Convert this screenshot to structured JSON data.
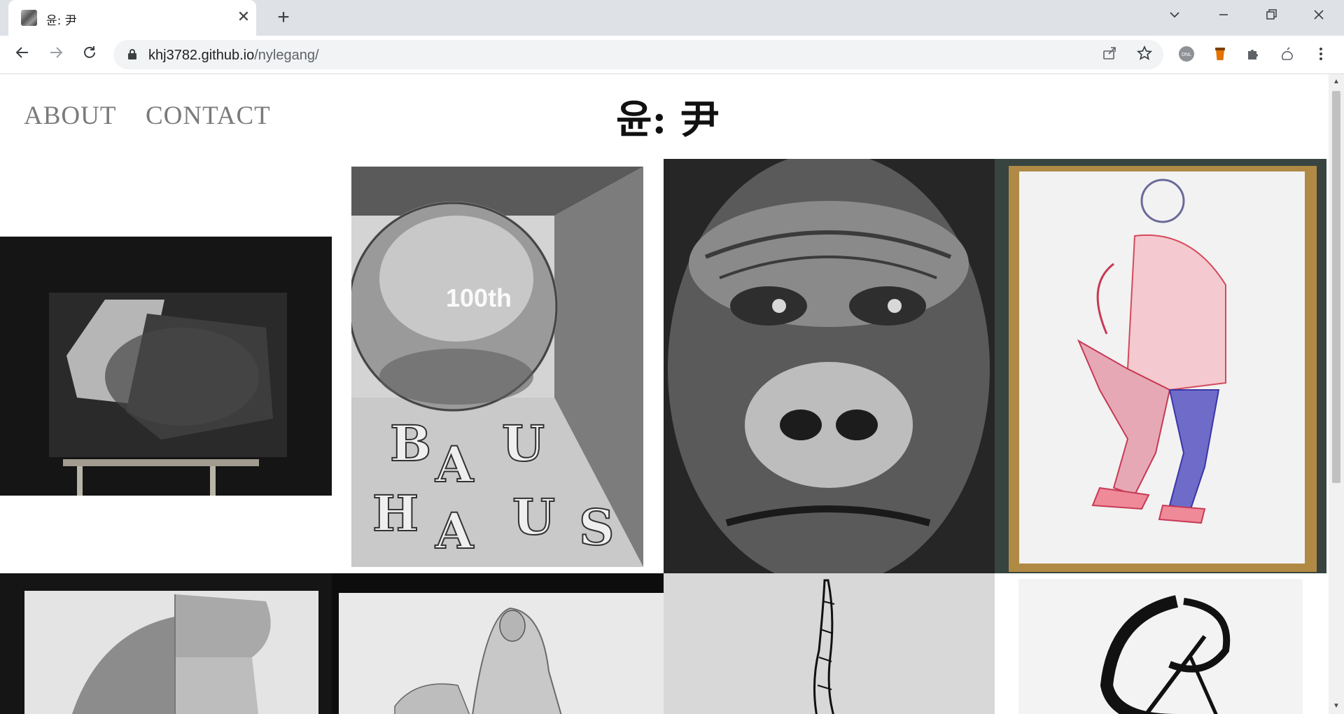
{
  "browser": {
    "tab_title": "윤: 尹",
    "tab_close": "✕",
    "new_tab": "+",
    "url_host": "khj3782.github.io",
    "url_path": "/nylegang/"
  },
  "site": {
    "nav": [
      "ABOUT",
      "CONTACT"
    ],
    "title": "윤: 尹"
  },
  "artworks": [
    {
      "name": "artwork-figure-shadow"
    },
    {
      "name": "artwork-bauhaus-sphere",
      "sphere_text": "100th",
      "letters": [
        "B",
        "A",
        "U",
        "H",
        "A",
        "U",
        "S"
      ]
    },
    {
      "name": "artwork-gorilla"
    },
    {
      "name": "artwork-seated-man"
    },
    {
      "name": "artwork-cap-portrait"
    },
    {
      "name": "artwork-pieta"
    },
    {
      "name": "artwork-ink-arm"
    },
    {
      "name": "artwork-calligraphy"
    }
  ],
  "icons": {
    "back": "arrow-left-icon",
    "forward": "arrow-right-icon",
    "reload": "reload-icon",
    "lock": "lock-icon",
    "share": "share-icon",
    "bookmark": "star-icon",
    "extensions": "puzzle-icon",
    "menu": "kebab-menu-icon"
  }
}
